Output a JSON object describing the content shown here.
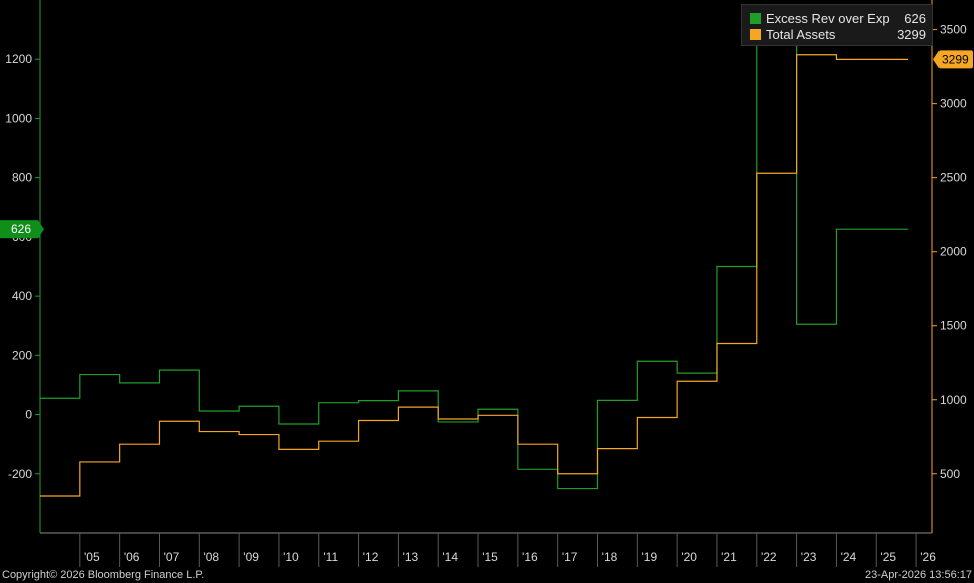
{
  "chart_data": {
    "type": "line",
    "step": "post",
    "categories": [
      "'05",
      "'06",
      "'07",
      "'08",
      "'09",
      "'10",
      "'11",
      "'12",
      "'13",
      "'14",
      "'15",
      "'16",
      "'17",
      "'18",
      "'19",
      "'20",
      "'21",
      "'22",
      "'23",
      "'24",
      "'25",
      "'26"
    ],
    "series": [
      {
        "name": "Excess Rev over Exp",
        "axis": "left",
        "color": "#1f9e2a",
        "x": [
          2004.0,
          2005.0,
          2006.0,
          2007.0,
          2008.0,
          2009.0,
          2010.0,
          2011.0,
          2012.0,
          2013.0,
          2014.0,
          2015.0,
          2016.0,
          2017.0,
          2018.0,
          2019.0,
          2020.0,
          2021.0,
          2022.0,
          2023.0,
          2024.0,
          2025.8
        ],
        "values": [
          55,
          135,
          107,
          150,
          12,
          28,
          -32,
          40,
          47,
          80,
          -25,
          18,
          -185,
          -250,
          48,
          180,
          140,
          500,
          1285,
          305,
          626,
          626
        ],
        "last_value": "626"
      },
      {
        "name": "Total Assets",
        "axis": "right",
        "color": "#f5a623",
        "x": [
          2004.0,
          2005.0,
          2006.0,
          2007.0,
          2008.0,
          2009.0,
          2010.0,
          2011.0,
          2012.0,
          2013.0,
          2014.0,
          2015.0,
          2016.0,
          2017.0,
          2018.0,
          2019.0,
          2020.0,
          2021.0,
          2022.0,
          2023.0,
          2024.0,
          2025.8
        ],
        "values": [
          350,
          580,
          700,
          855,
          785,
          765,
          665,
          720,
          860,
          950,
          870,
          895,
          700,
          500,
          670,
          880,
          1125,
          1380,
          2530,
          3330,
          3299,
          3299
        ],
        "last_value": "3299"
      }
    ],
    "left_axis": {
      "ylim": [
        -400,
        1400
      ],
      "ticks": [
        -200,
        0,
        200,
        400,
        600,
        800,
        1000,
        1200
      ]
    },
    "right_axis": {
      "ylim": [
        100,
        3700
      ],
      "ticks": [
        500,
        1000,
        1500,
        2000,
        2500,
        3000,
        3500
      ]
    },
    "x_axis": {
      "xlim": [
        2004.0,
        2026.4
      ]
    },
    "grid": false,
    "legend_placement": "top-right"
  },
  "legend": [
    {
      "name": "Excess Rev over Exp",
      "value": "626",
      "color": "#1f9e2a"
    },
    {
      "name": "Total Assets",
      "value": "3299",
      "color": "#f5a623"
    }
  ],
  "footer": {
    "copyright": "Copyright© 2026 Bloomberg Finance L.P.",
    "timestamp": "23-Apr-2026 13:56:17"
  }
}
